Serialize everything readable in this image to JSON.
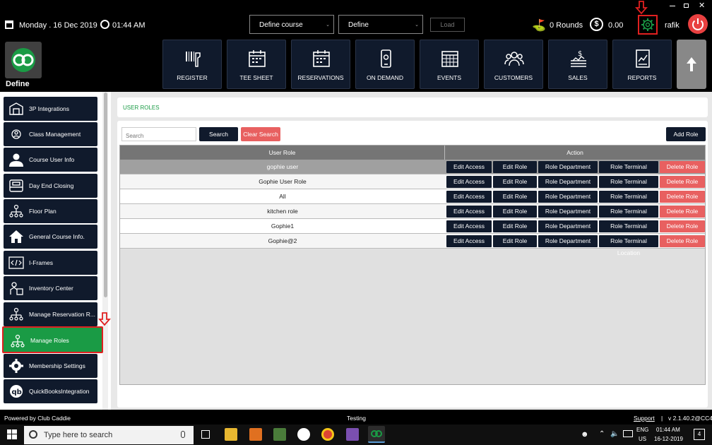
{
  "topbar": {
    "date": "Monday . 16 Dec 2019",
    "time": "01:44 AM",
    "course_select": "Define  course",
    "define_select": "Define",
    "load_label": "Load",
    "rounds": "0 Rounds",
    "amount": "0.00",
    "user": "rafik"
  },
  "logo": {
    "label": "Define"
  },
  "nav": [
    {
      "label": "REGISTER",
      "icon": "barcode-scanner-icon"
    },
    {
      "label": "TEE SHEET",
      "icon": "calendar-icon"
    },
    {
      "label": "RESERVATIONS",
      "icon": "calendar-icon"
    },
    {
      "label": "ON DEMAND",
      "icon": "mobile-icon"
    },
    {
      "label": "EVENTS",
      "icon": "events-calendar-icon"
    },
    {
      "label": "CUSTOMERS",
      "icon": "customers-icon"
    },
    {
      "label": "SALES",
      "icon": "sales-icon"
    },
    {
      "label": "REPORTS",
      "icon": "reports-icon"
    }
  ],
  "sidebar": {
    "items": [
      {
        "label": "3P Integrations"
      },
      {
        "label": "Class Management"
      },
      {
        "label": "Course User Info"
      },
      {
        "label": "Day End Closing"
      },
      {
        "label": "Floor Plan"
      },
      {
        "label": "General Course Info."
      },
      {
        "label": "I-Frames"
      },
      {
        "label": "Inventory Center"
      },
      {
        "label": "Manage Reservation R..."
      },
      {
        "label": "Manage Roles"
      },
      {
        "label": "Membership Settings"
      },
      {
        "label": "QuickBooksIntegration"
      }
    ]
  },
  "page": {
    "title": "USER ROLES",
    "search_placeholder": "Search",
    "search_label": "Search",
    "clear_label": "Clear Search",
    "add_label": "Add Role"
  },
  "table": {
    "headers": [
      "User Role",
      "Action"
    ],
    "actions": [
      "Edit Access",
      "Edit Role",
      "Role Department",
      "Role Terminal Location",
      "Delete Role"
    ],
    "rows": [
      "gophie user",
      "Gophie User Role",
      "All",
      "kitchen role",
      "Gophie1",
      "Gophie@2"
    ]
  },
  "footer": {
    "powered": "Powered by Club Caddie",
    "env": "Testing",
    "support": "Support",
    "sep": "|",
    "version": "v 2.1.40.2@CC4"
  },
  "taskbar": {
    "search_placeholder": "Type here to search",
    "lang1": "ENG",
    "lang2": "US",
    "time": "01:44 AM",
    "date": "16-12-2019",
    "notif_count": "4"
  },
  "colors": {
    "accent_green": "#1a9b45",
    "nav_dark": "#101a2c",
    "danger": "#e86060",
    "highlight_red": "#e02020"
  }
}
